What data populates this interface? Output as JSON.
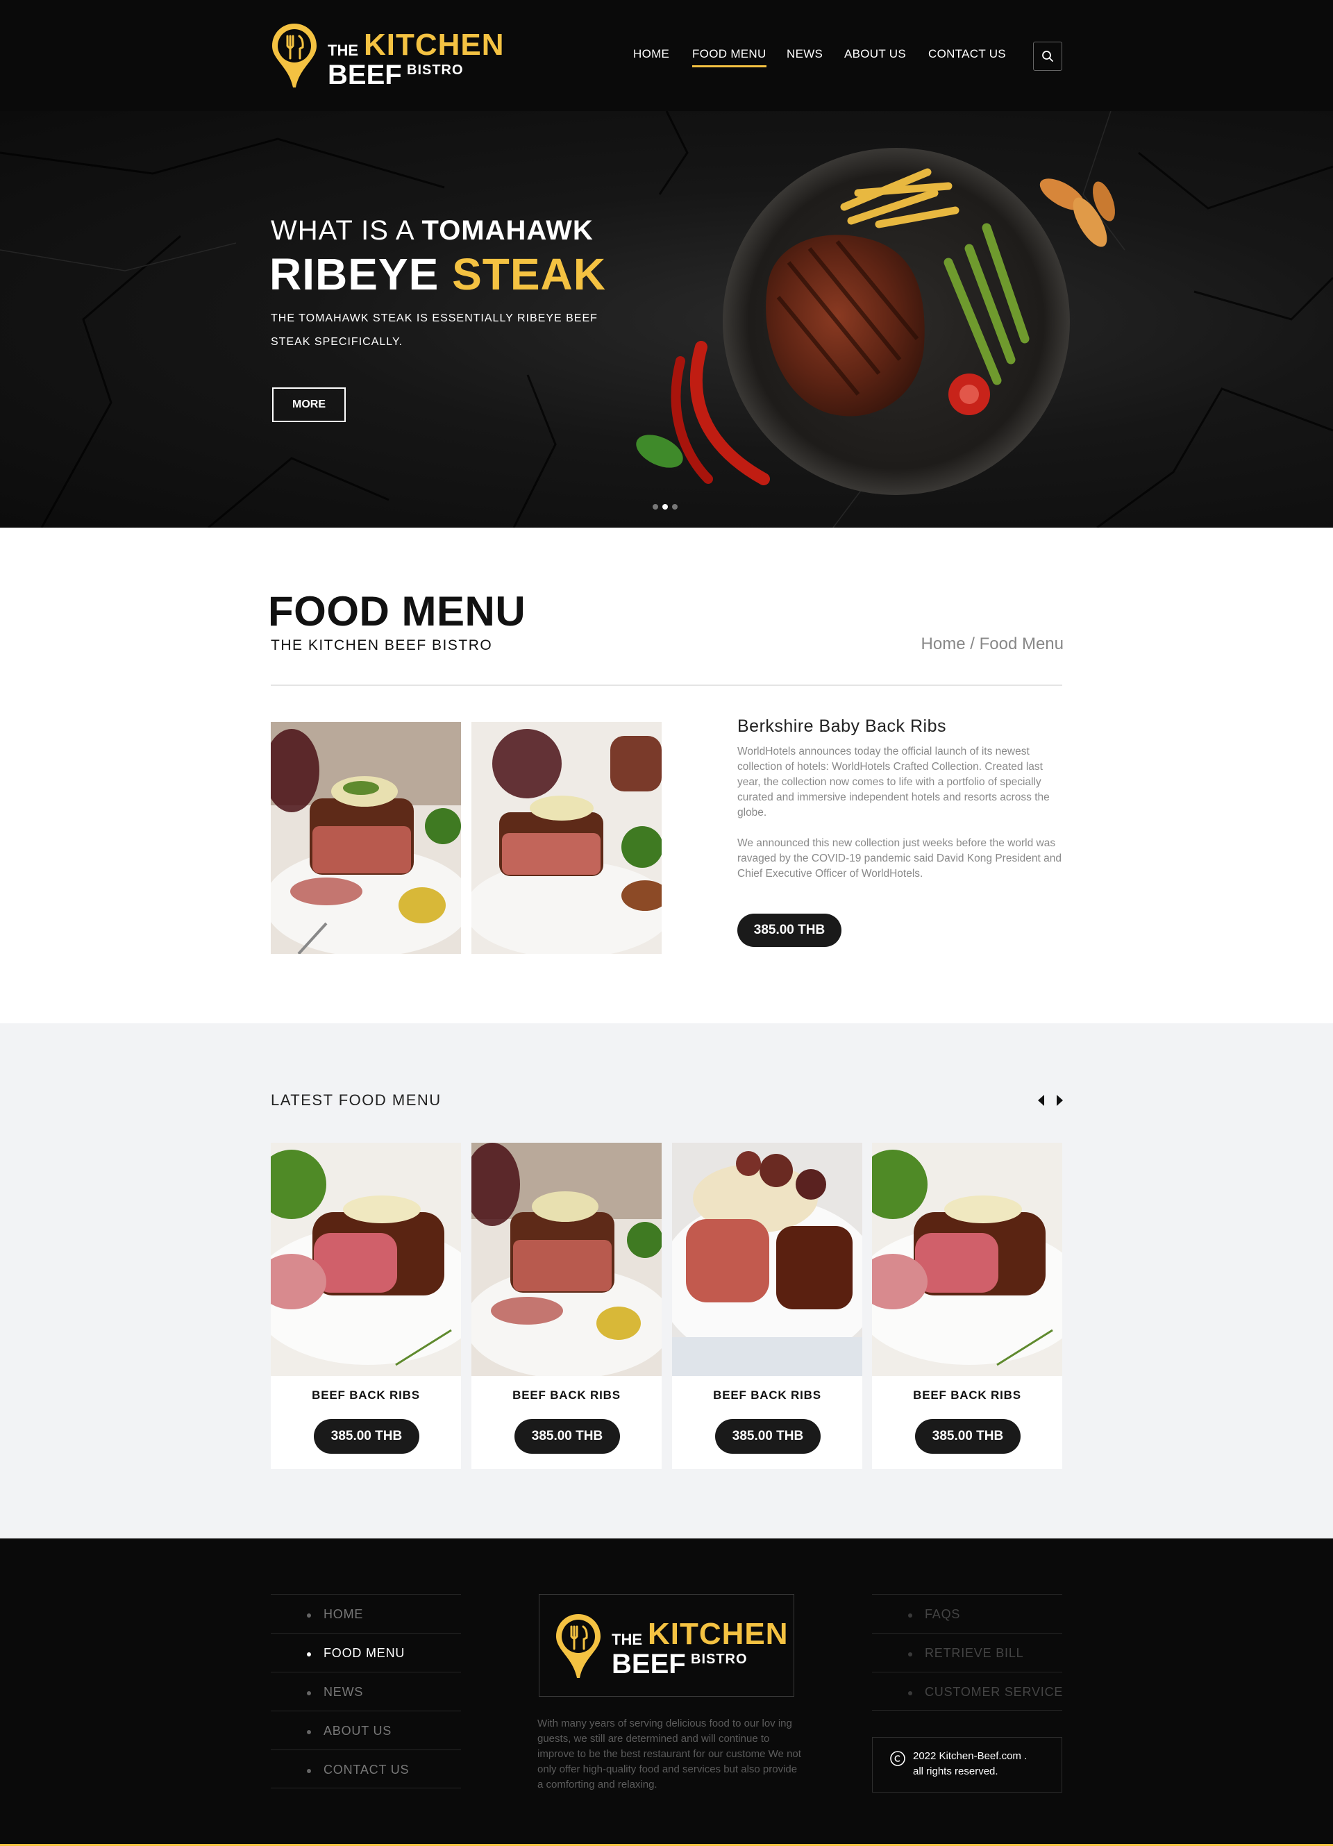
{
  "brand": {
    "logo_the": "THE",
    "logo_kitchen": "KITCHEN",
    "logo_beef": "BEEF",
    "logo_bistro": "BISTRO",
    "accent_color": "#f4c242",
    "dark_color": "#0a0a0a"
  },
  "nav": {
    "items": [
      {
        "label": "HOME"
      },
      {
        "label": "FOOD MENU",
        "active": true
      },
      {
        "label": "NEWS"
      },
      {
        "label": "ABOUT US"
      },
      {
        "label": "CONTACT US"
      }
    ],
    "search_icon": "search-icon"
  },
  "hero": {
    "line1_plain": "WHAT IS A",
    "line1_bold": "TOMAHAWK",
    "line2_white": "RIBEYE",
    "line2_yellow": "STEAK",
    "description": "THE TOMAHAWK STEAK IS ESSENTIALLY RIBEYE BEEF STEAK SPECIFICALLY.",
    "more_label": "MORE",
    "slide_count": 3,
    "active_slide": 2
  },
  "food_menu": {
    "title": "FOOD MENU",
    "subtitle": "THE KITCHEN BEEF BISTRO",
    "breadcrumb": {
      "home": "Home",
      "separator": " / ",
      "current": "Food Menu"
    },
    "item": {
      "name": "Berkshire Baby Back Ribs",
      "paragraphs": [
        "WorldHotels announces today the official launch of its newest collection of hotels: WorldHotels Crafted Collection.  Created last year, the collection now comes to life with a portfolio of specially curated and immersive independent hotels and resorts across the globe.",
        "We announced this new collection just weeks before the world was ravaged by the COVID-19 pandemic said David Kong President and Chief Executive Officer of WorldHotels."
      ],
      "price": "385.00  THB"
    }
  },
  "latest": {
    "title": "LATEST FOOD MENU",
    "prev_icon": "arrow-left-icon",
    "next_icon": "arrow-right-icon",
    "cards": [
      {
        "name": "BEEF BACK RIBS",
        "price": "385.00  THB"
      },
      {
        "name": "BEEF BACK RIBS",
        "price": "385.00  THB"
      },
      {
        "name": "BEEF BACK RIBS",
        "price": "385.00  THB"
      },
      {
        "name": "BEEF BACK RIBS",
        "price": "385.00  THB"
      }
    ]
  },
  "footer": {
    "menu": [
      {
        "label": "HOME"
      },
      {
        "label": "FOOD MENU",
        "active": true
      },
      {
        "label": "NEWS"
      },
      {
        "label": "ABOUT US"
      },
      {
        "label": "CONTACT US"
      }
    ],
    "links": [
      {
        "label": "FAQS"
      },
      {
        "label": "RETRIEVE BILL"
      },
      {
        "label": "CUSTOMER SERVICE"
      }
    ],
    "description": "With many years of serving delicious food to our lov ing guests, we still are determined and will continue to improve to be the best restaurant for our custome We not only offer high-quality food and services but also provide a comforting and relaxing.",
    "copyright_line1": "2022 Kitchen-Beef.com .",
    "copyright_line2": "all rights reserved."
  }
}
